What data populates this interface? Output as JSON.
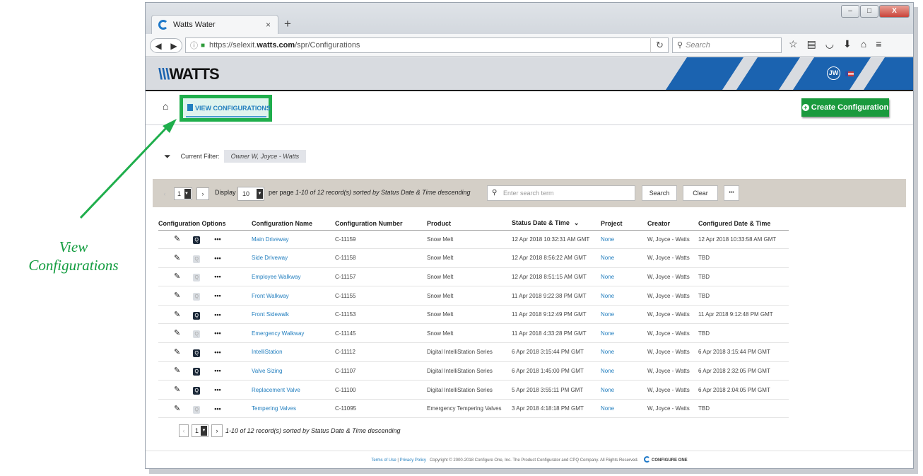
{
  "annotation": {
    "line1": "View",
    "line2": "Configurations"
  },
  "browser": {
    "tab_title": "Watts Water",
    "tab_close": "×",
    "new_tab": "+",
    "url_prefix": "https://selexit.",
    "url_domain": "watts.com",
    "url_path": "/spr/Configurations",
    "search_placeholder": "Search",
    "min": "–",
    "max": "□",
    "close": "X"
  },
  "header": {
    "logo": "WATTS",
    "avatar_initials": "JW"
  },
  "toolbar": {
    "view_configurations": "VIEW CONFIGURATIONS",
    "create_button": "Create Configuration"
  },
  "filter": {
    "label": "Current Filter:",
    "value": "Owner  W, Joyce - Watts"
  },
  "pager": {
    "page": "1",
    "display_label": "Display",
    "per_page_value": "10",
    "per_page_label": "per page",
    "summary": "1-10 of 12 record(s) sorted by Status Date & Time descending",
    "search_placeholder": "Enter search term",
    "search_button": "Search",
    "clear_button": "Clear",
    "more_button": "•••"
  },
  "table": {
    "columns": [
      "Configuration Options",
      "Configuration Name",
      "Configuration Number",
      "Product",
      "Status Date & Time",
      "Project",
      "Creator",
      "Configured Date & Time"
    ],
    "rows": [
      {
        "name": "Main Driveway",
        "number": "C-11159",
        "product": "Snow Melt",
        "status": "12 Apr 2018 10:32:31 AM GMT",
        "project": "None",
        "creator": "W, Joyce - Watts",
        "configured": "12 Apr 2018 10:33:58 AM GMT",
        "preview": true
      },
      {
        "name": "Side Driveway",
        "number": "C-11158",
        "product": "Snow Melt",
        "status": "12 Apr 2018 8:56:22 AM GMT",
        "project": "None",
        "creator": "W, Joyce - Watts",
        "configured": "TBD",
        "preview": false
      },
      {
        "name": "Employee Walkway",
        "number": "C-11157",
        "product": "Snow Melt",
        "status": "12 Apr 2018 8:51:15 AM GMT",
        "project": "None",
        "creator": "W, Joyce - Watts",
        "configured": "TBD",
        "preview": false
      },
      {
        "name": "Front Walkway",
        "number": "C-11155",
        "product": "Snow Melt",
        "status": "11 Apr 2018 9:22:38 PM GMT",
        "project": "None",
        "creator": "W, Joyce - Watts",
        "configured": "TBD",
        "preview": false
      },
      {
        "name": "Front Sidewalk",
        "number": "C-11153",
        "product": "Snow Melt",
        "status": "11 Apr 2018 9:12:49 PM GMT",
        "project": "None",
        "creator": "W, Joyce - Watts",
        "configured": "11 Apr 2018 9:12:48 PM GMT",
        "preview": true
      },
      {
        "name": "Emergency Walkway",
        "number": "C-11145",
        "product": "Snow Melt",
        "status": "11 Apr 2018 4:33:28 PM GMT",
        "project": "None",
        "creator": "W, Joyce - Watts",
        "configured": "TBD",
        "preview": false
      },
      {
        "name": "IntelliStation",
        "number": "C-11112",
        "product": "Digital IntelliStation Series",
        "status": "6 Apr 2018 3:15:44 PM GMT",
        "project": "None",
        "creator": "W, Joyce - Watts",
        "configured": "6 Apr 2018 3:15:44 PM GMT",
        "preview": true
      },
      {
        "name": "Valve Sizing",
        "number": "C-11107",
        "product": "Digital IntelliStation Series",
        "status": "6 Apr 2018 1:45:00 PM GMT",
        "project": "None",
        "creator": "W, Joyce - Watts",
        "configured": "6 Apr 2018 2:32:05 PM GMT",
        "preview": true
      },
      {
        "name": "Replacement Valve",
        "number": "C-11100",
        "product": "Digital IntelliStation Series",
        "status": "5 Apr 2018 3:55:11 PM GMT",
        "project": "None",
        "creator": "W, Joyce - Watts",
        "configured": "6 Apr 2018 2:04:05 PM GMT",
        "preview": true
      },
      {
        "name": "Tempering Valves",
        "number": "C-11095",
        "product": "Emergency Tempering Valves",
        "status": "3 Apr 2018 4:18:18 PM GMT",
        "project": "None",
        "creator": "W, Joyce - Watts",
        "configured": "TBD",
        "preview": false
      }
    ]
  },
  "bottom_pager": {
    "page": "1",
    "summary": "1-10 of 12 record(s) sorted by Status Date & Time descending"
  },
  "footer": {
    "terms": "Terms of Use",
    "sep": "|",
    "privacy": "Privacy Policy",
    "copyright": "Copyright © 2000-2018 Configure One, Inc. The Product Configurator and CPQ Company. All Rights Reserved.",
    "brand": "CONFIGURE ONE"
  },
  "colors": {
    "accent_green": "#1fae4c",
    "link_blue": "#237fbf",
    "brand_blue": "#1b63b0",
    "create_green": "#1a9a3d"
  }
}
